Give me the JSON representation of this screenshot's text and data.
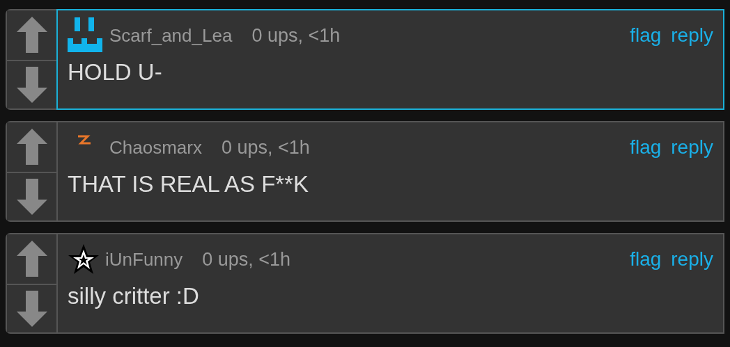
{
  "comments": [
    {
      "avatar": {
        "kind": "pixel"
      },
      "username": "Scarf_and_Lea",
      "meta": "0 ups, <1h",
      "actions": [
        "flag",
        "reply"
      ],
      "text": "HOLD U-",
      "selected": true
    },
    {
      "avatar": {
        "kind": "bolt"
      },
      "username": "Chaosmarx",
      "meta": "0 ups, <1h",
      "actions": [
        "flag",
        "reply"
      ],
      "text": "THAT IS REAL AS F**K",
      "selected": false
    },
    {
      "avatar": {
        "kind": "star"
      },
      "username": "iUnFunny",
      "meta": "0 ups, <1h",
      "actions": [
        "flag",
        "reply"
      ],
      "text": "silly critter :D",
      "selected": false
    }
  ]
}
